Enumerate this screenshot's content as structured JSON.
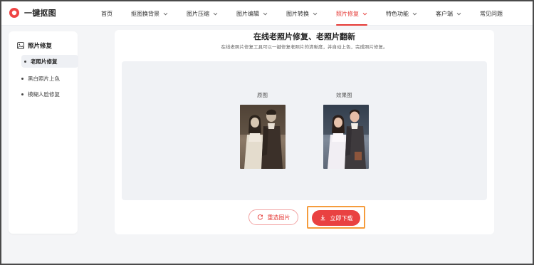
{
  "app": {
    "name": "一键抠图"
  },
  "nav": {
    "items": [
      {
        "label": "首页",
        "dropdown": false,
        "active": false
      },
      {
        "label": "抠图换背景",
        "dropdown": true,
        "active": false
      },
      {
        "label": "图片压缩",
        "dropdown": true,
        "active": false
      },
      {
        "label": "图片编辑",
        "dropdown": true,
        "active": false
      },
      {
        "label": "图片转换",
        "dropdown": true,
        "active": false
      },
      {
        "label": "照片修复",
        "dropdown": true,
        "active": true
      },
      {
        "label": "特色功能",
        "dropdown": true,
        "active": false
      },
      {
        "label": "客户端",
        "dropdown": true,
        "active": false
      },
      {
        "label": "常见问题",
        "dropdown": false,
        "active": false
      }
    ]
  },
  "sidebar": {
    "header": {
      "label": "照片修复",
      "icon": "photo-icon"
    },
    "items": [
      {
        "label": "老照片修复",
        "active": true
      },
      {
        "label": "黑白照片上色",
        "active": false
      },
      {
        "label": "模糊人脸修复",
        "active": false
      }
    ]
  },
  "main": {
    "title": "在线老照片修复、老照片翻新",
    "subtitle": "在线老照片修复工具可以一键修复老照片的清晰度，并自动上色，完成照片修复。",
    "preview": {
      "original_label": "原图",
      "result_label": "效果图"
    },
    "buttons": {
      "reselect": "重选图片",
      "download": "立即下载"
    }
  },
  "colors": {
    "accent": "#e53935",
    "download_bg": "#e94141",
    "highlight_border": "#f59c3d"
  }
}
